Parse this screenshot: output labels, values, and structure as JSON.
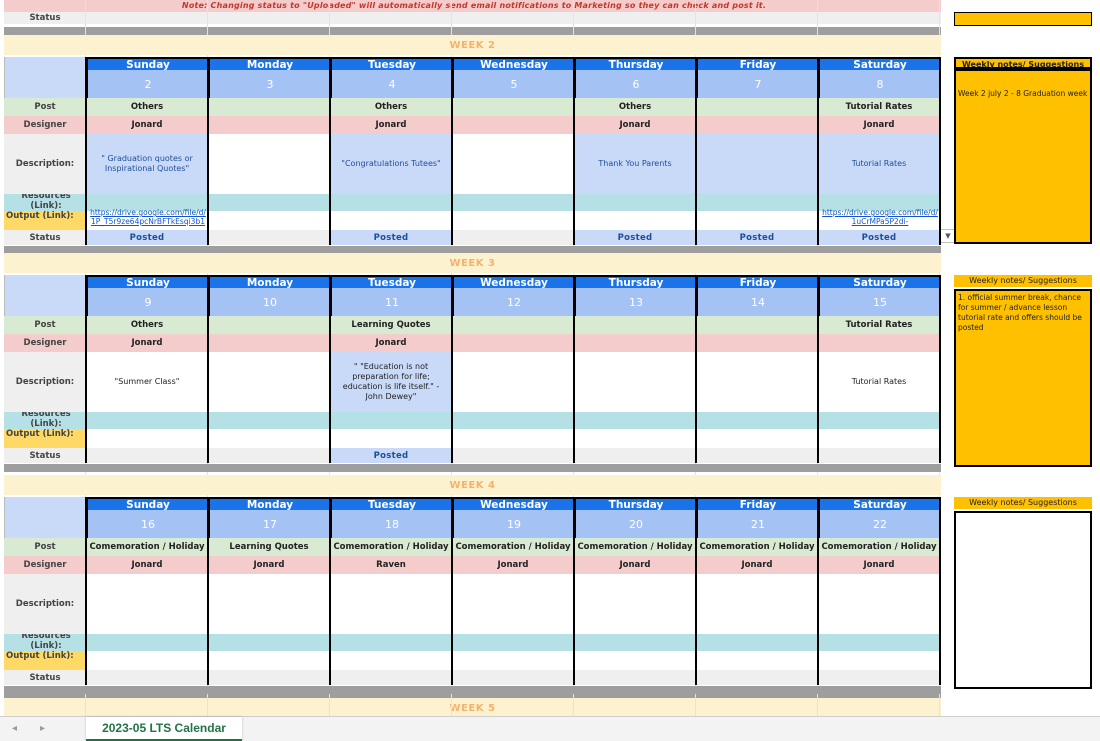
{
  "note": "Note: Changing status to \"Uploaded\" will automatically send email notifications to Marketing so they can check and post it.",
  "labels": {
    "post": "Post",
    "designer": "Designer",
    "description": "Description:",
    "resources": "Resources (Link):",
    "output": "Output (Link):",
    "status": "Status"
  },
  "days": [
    "Sunday",
    "Monday",
    "Tuesday",
    "Wednesday",
    "Thursday",
    "Friday",
    "Saturday"
  ],
  "notes_header": "Weekly notes/ Suggestions",
  "weeks": [
    {
      "title": "WEEK 2",
      "dates": [
        "2",
        "3",
        "4",
        "5",
        "6",
        "7",
        "8"
      ],
      "post": [
        "Others",
        "",
        "Others",
        "",
        "Others",
        "",
        "Tutorial Rates"
      ],
      "designer": [
        "Jonard",
        "",
        "Jonard",
        "",
        "Jonard",
        "",
        "Jonard"
      ],
      "description": [
        "\" Graduation quotes or Inspirational Quotes\"",
        "",
        "\"Congratulations Tutees\"",
        "",
        "Thank You Parents",
        "",
        "Tutorial Rates"
      ],
      "output": [
        "https://drive.google.com/file/d/1P_T5r9ze64pcNrBFTkEsqi3b1",
        "",
        "",
        "",
        "",
        "",
        "https://drive.google.com/file/d/1uCrMPa5P2di-"
      ],
      "status": [
        "Posted",
        "",
        "Posted",
        "",
        "Posted",
        "Posted",
        "Posted"
      ],
      "notes": "Week 2 july 2 - 8 Graduation week"
    },
    {
      "title": "WEEK 3",
      "dates": [
        "9",
        "10",
        "11",
        "12",
        "13",
        "14",
        "15"
      ],
      "post": [
        "Others",
        "",
        "Learning Quotes",
        "",
        "",
        "",
        "Tutorial Rates"
      ],
      "designer": [
        "Jonard",
        "",
        "Jonard",
        "",
        "",
        "",
        ""
      ],
      "description": [
        "\"Summer Class\"",
        "",
        "\" \"Education is not preparation for life; education is life itself.\" - John Dewey\"",
        "",
        "",
        "",
        "Tutorial Rates"
      ],
      "output": [
        "",
        "",
        "",
        "",
        "",
        "",
        ""
      ],
      "status": [
        "",
        "",
        "Posted",
        "",
        "",
        "",
        ""
      ],
      "notes": "1. official summer break, chance for summer / advance lesson tutorial rate and offers should be posted"
    },
    {
      "title": "WEEK 4",
      "dates": [
        "16",
        "17",
        "18",
        "19",
        "20",
        "21",
        "22"
      ],
      "post": [
        "Comemoration / Holiday",
        "Learning Quotes",
        "Comemoration / Holiday",
        "Comemoration / Holiday",
        "Comemoration / Holiday",
        "Comemoration / Holiday",
        "Comemoration / Holiday"
      ],
      "designer": [
        "Jonard",
        "Jonard",
        "Raven",
        "Jonard",
        "Jonard",
        "Jonard",
        "Jonard"
      ],
      "description": [
        "",
        "",
        "",
        "",
        "",
        "",
        ""
      ],
      "output": [
        "",
        "",
        "",
        "",
        "",
        "",
        ""
      ],
      "status": [
        "",
        "",
        "",
        "",
        "",
        "",
        ""
      ],
      "notes": ""
    }
  ],
  "week5_title": "WEEK 5",
  "sheet_tab": "2023-05 LTS Calendar",
  "colors": {
    "day_header": "#1a73e8",
    "date_row": "#a4c2f4",
    "post_row": "#d9ead3",
    "designer_row": "#f4cccc",
    "resources_row": "#b4e0e6",
    "output_row": "#ffd966",
    "notes_fill": "#ffc000",
    "week_title": "#f6b26b"
  }
}
